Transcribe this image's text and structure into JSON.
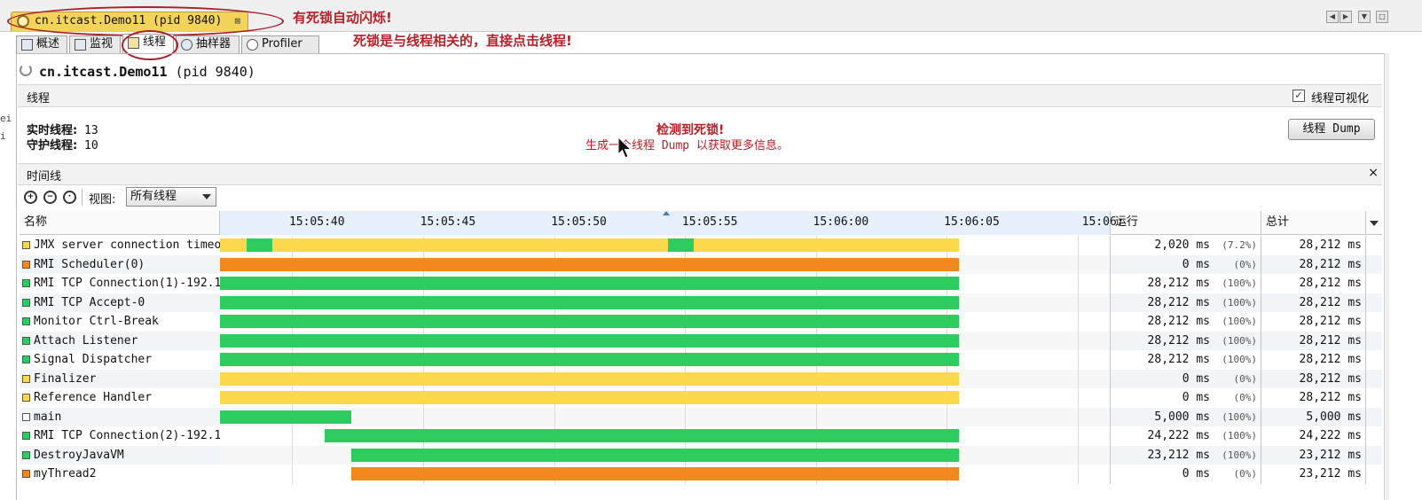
{
  "doc_tab": {
    "title": "cn.itcast.Demo11 (pid 9840)",
    "close": "⊠"
  },
  "annotations": {
    "blink": "有死锁自动闪烁!",
    "click_threads": "死锁是与线程相关的，直接点击线程!"
  },
  "left_edge": [
    "ei",
    "i"
  ],
  "tabs": [
    {
      "label": "概述",
      "icon": "overview-icon"
    },
    {
      "label": "监视",
      "icon": "monitor-icon"
    },
    {
      "label": "线程",
      "icon": "threads-icon",
      "active": true
    },
    {
      "label": "抽样器",
      "icon": "sampler-icon"
    },
    {
      "label": "Profiler",
      "icon": "profiler-icon"
    }
  ],
  "page": {
    "name": "cn.itcast.Demo11",
    "pid": "(pid 9840)"
  },
  "threads_section": {
    "label": "线程",
    "visualize_label": "线程可视化",
    "visualize_checked": true
  },
  "stats": {
    "live_label": "实时线程:",
    "live_value": "13",
    "daemon_label": "守护线程:",
    "daemon_value": "10"
  },
  "deadlock": {
    "title": "检测到死锁!",
    "message": "生成一个线程 Dump 以获取更多信息。"
  },
  "dump_button": "线程 Dump",
  "timeline_section": {
    "label": "时间线",
    "close": "×"
  },
  "toolbar": {
    "view_label": "视图:",
    "view_value": "所有线程"
  },
  "columns": {
    "name": "名称",
    "run": "运行",
    "total": "总计"
  },
  "colors": {
    "running": "#2ecc5f",
    "sleeping": "#fbd84c",
    "wait": "#f08a1e",
    "park": "#f08a1e",
    "monitor": "#f08a1e"
  },
  "chart_data": {
    "type": "timeline",
    "x_ticks": [
      "15:05:40",
      "15:05:45",
      "15:05:50",
      "15:05:55",
      "15:06:00",
      "15:06:05",
      "15:06:"
    ],
    "x_range_seconds": [
      0,
      34
    ],
    "tick_seconds": [
      3.7,
      8.7,
      13.7,
      18.7,
      23.7,
      28.7,
      33.7
    ],
    "end_seconds": 28.2,
    "rows": [
      {
        "name": "JMX server connection timeo",
        "state_color": "#fbd84c",
        "run": "2,020 ms",
        "pct": "(7.2%)",
        "total": "28,212 ms",
        "segments": [
          {
            "s": 0,
            "e": 1.0,
            "c": "#fbd84c"
          },
          {
            "s": 1.0,
            "e": 2.0,
            "c": "#2ecc5f"
          },
          {
            "s": 2.0,
            "e": 17.1,
            "c": "#fbd84c"
          },
          {
            "s": 17.1,
            "e": 18.1,
            "c": "#2ecc5f"
          },
          {
            "s": 18.1,
            "e": 28.2,
            "c": "#fbd84c"
          }
        ]
      },
      {
        "name": "RMI Scheduler(0)",
        "state_color": "#f08a1e",
        "run": "0 ms",
        "pct": "(0%)",
        "total": "28,212 ms",
        "segments": [
          {
            "s": 0,
            "e": 28.2,
            "c": "#f08a1e"
          }
        ]
      },
      {
        "name": "RMI TCP Connection(1)-192.1",
        "state_color": "#2ecc5f",
        "run": "28,212 ms",
        "pct": "(100%)",
        "total": "28,212 ms",
        "segments": [
          {
            "s": 0,
            "e": 28.2,
            "c": "#2ecc5f"
          }
        ]
      },
      {
        "name": "RMI TCP Accept-0",
        "state_color": "#2ecc5f",
        "run": "28,212 ms",
        "pct": "(100%)",
        "total": "28,212 ms",
        "segments": [
          {
            "s": 0,
            "e": 28.2,
            "c": "#2ecc5f"
          }
        ]
      },
      {
        "name": "Monitor Ctrl-Break",
        "state_color": "#2ecc5f",
        "run": "28,212 ms",
        "pct": "(100%)",
        "total": "28,212 ms",
        "segments": [
          {
            "s": 0,
            "e": 28.2,
            "c": "#2ecc5f"
          }
        ]
      },
      {
        "name": "Attach Listener",
        "state_color": "#2ecc5f",
        "run": "28,212 ms",
        "pct": "(100%)",
        "total": "28,212 ms",
        "segments": [
          {
            "s": 0,
            "e": 28.2,
            "c": "#2ecc5f"
          }
        ]
      },
      {
        "name": "Signal Dispatcher",
        "state_color": "#2ecc5f",
        "run": "28,212 ms",
        "pct": "(100%)",
        "total": "28,212 ms",
        "segments": [
          {
            "s": 0,
            "e": 28.2,
            "c": "#2ecc5f"
          }
        ]
      },
      {
        "name": "Finalizer",
        "state_color": "#fbd84c",
        "run": "0 ms",
        "pct": "(0%)",
        "total": "28,212 ms",
        "segments": [
          {
            "s": 0,
            "e": 28.2,
            "c": "#fbd84c"
          }
        ]
      },
      {
        "name": "Reference Handler",
        "state_color": "#fbd84c",
        "run": "0 ms",
        "pct": "(0%)",
        "total": "28,212 ms",
        "segments": [
          {
            "s": 0,
            "e": 28.2,
            "c": "#fbd84c"
          }
        ]
      },
      {
        "name": "main",
        "state_color": "#ffffff",
        "run": "5,000 ms",
        "pct": "(100%)",
        "total": "5,000 ms",
        "segments": [
          {
            "s": 0,
            "e": 5.0,
            "c": "#2ecc5f"
          }
        ]
      },
      {
        "name": "RMI TCP Connection(2)-192.1",
        "state_color": "#2ecc5f",
        "run": "24,222 ms",
        "pct": "(100%)",
        "total": "24,222 ms",
        "segments": [
          {
            "s": 4.0,
            "e": 28.2,
            "c": "#2ecc5f"
          }
        ]
      },
      {
        "name": "DestroyJavaVM",
        "state_color": "#2ecc5f",
        "run": "23,212 ms",
        "pct": "(100%)",
        "total": "23,212 ms",
        "segments": [
          {
            "s": 5.0,
            "e": 28.2,
            "c": "#2ecc5f"
          }
        ]
      },
      {
        "name": "myThread2",
        "state_color": "#f08a1e",
        "run": "0 ms",
        "pct": "(0%)",
        "total": "23,212 ms",
        "segments": [
          {
            "s": 5.0,
            "e": 28.2,
            "c": "#f08a1e"
          }
        ]
      }
    ]
  }
}
